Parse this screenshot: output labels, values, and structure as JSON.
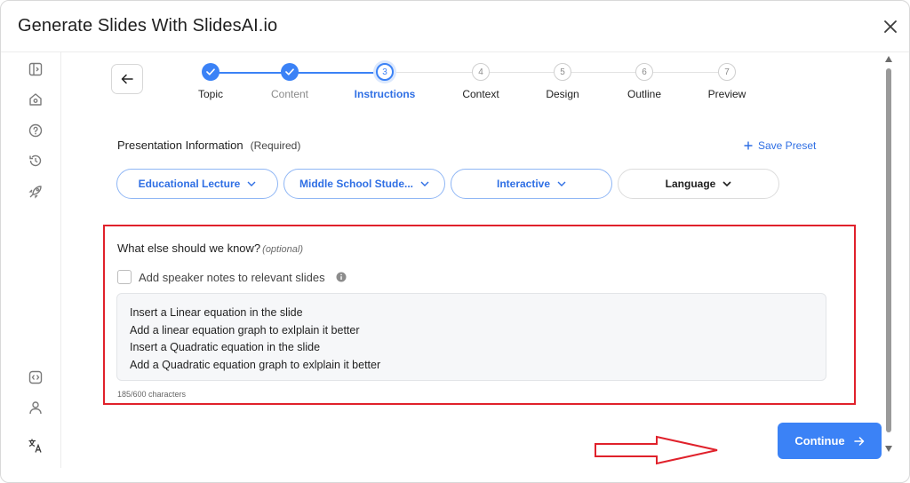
{
  "dialog": {
    "title": "Generate Slides With SlidesAI.io"
  },
  "stepper": {
    "steps": [
      {
        "num": "1",
        "label": "Topic",
        "state": "done"
      },
      {
        "num": "2",
        "label": "Content",
        "state": "done"
      },
      {
        "num": "3",
        "label": "Instructions",
        "state": "active"
      },
      {
        "num": "4",
        "label": "Context",
        "state": "todo"
      },
      {
        "num": "5",
        "label": "Design",
        "state": "todo"
      },
      {
        "num": "6",
        "label": "Outline",
        "state": "todo"
      },
      {
        "num": "7",
        "label": "Preview",
        "state": "todo"
      }
    ]
  },
  "presentation_info": {
    "title": "Presentation Information",
    "required": "(Required)",
    "save_preset": "Save Preset",
    "pills": [
      {
        "label": "Educational Lecture"
      },
      {
        "label": "Middle School Stude..."
      },
      {
        "label": "Interactive"
      },
      {
        "label": "Language"
      }
    ]
  },
  "instructions": {
    "question": "What else should we know?",
    "optional": "(optional)",
    "speaker_notes_label": "Add speaker notes to relevant slides",
    "speaker_notes_checked": false,
    "lines": [
      "Insert a Linear equation in the slide",
      "Add a linear equation graph to exlplain it better",
      "Insert a Quadratic equation in the slide",
      "Add a Quadratic equation graph to exlplain it better"
    ],
    "char_count": "185/600 characters"
  },
  "footer": {
    "continue_label": "Continue"
  },
  "colors": {
    "accent": "#3b82f6",
    "annotation": "#e0212b"
  }
}
